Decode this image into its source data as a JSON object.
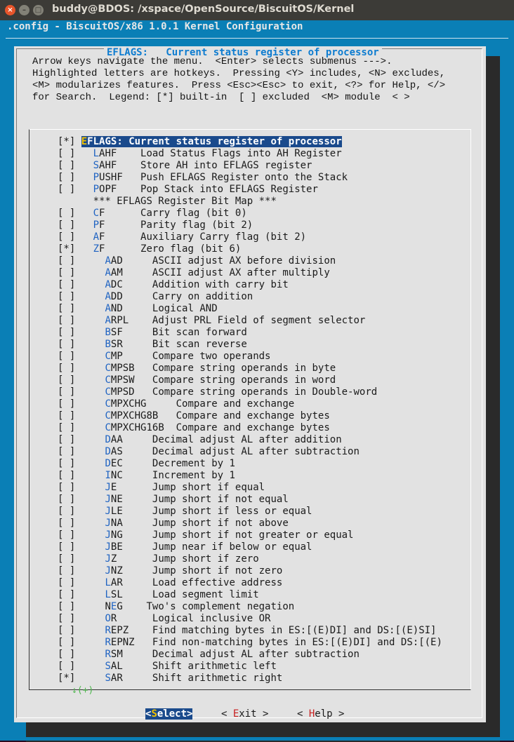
{
  "window": {
    "title": "buddy@BDOS: /xspace/OpenSource/BiscuitOS/Kernel",
    "close_glyph": "×",
    "min_glyph": "–",
    "max_glyph": "□"
  },
  "terminal": {
    "config_title": ".config - BiscuitOS/x86 1.0.1 Kernel Configuration"
  },
  "dialog": {
    "title": "EFLAGS:   Current status register of processor",
    "help_lines": [
      "Arrow keys navigate the menu.  <Enter> selects submenus --->.",
      "Highlighted letters are hotkeys.  Pressing <Y> includes, <N> excludes,",
      "<M> modularizes features.  Press <Esc><Esc> to exit, <?> for Help, </>",
      "for Search.  Legend: [*] built-in  [ ] excluded  <M> module  < >"
    ],
    "more_indicator": "↓(+)",
    "buttons": {
      "select": {
        "hotkey": "S",
        "rest": "elect",
        "prefix": "<",
        "suffix": ">"
      },
      "exit": {
        "hotkey": "E",
        "rest": "xit",
        "prefix": "< ",
        "suffix": " >"
      },
      "help": {
        "hotkey": "H",
        "rest": "elp",
        "prefix": "< ",
        "suffix": " >"
      }
    }
  },
  "menu": [
    {
      "check": "[*]",
      "indent": "",
      "hotkey": "E",
      "name": "FLAGS:",
      "desc": "Current status register of processor",
      "selected": true,
      "pad": 1
    },
    {
      "check": "[ ]",
      "indent": "  ",
      "hotkey": "L",
      "name": "AHF",
      "desc": "Load Status Flags into AH Register",
      "pad": 4
    },
    {
      "check": "[ ]",
      "indent": "  ",
      "hotkey": "S",
      "name": "AHF",
      "desc": "Store AH into EFLAGS register",
      "pad": 4
    },
    {
      "check": "[ ]",
      "indent": "  ",
      "hotkey": "P",
      "name": "USHF",
      "desc": "Push EFLAGS Register onto the Stack",
      "pad": 3
    },
    {
      "check": "[ ]",
      "indent": "  ",
      "hotkey": "P",
      "name": "OPF",
      "desc": "Pop Stack into EFLAGS Register",
      "pad": 4
    },
    {
      "check": "   ",
      "indent": "  ",
      "hotkey": "",
      "name": "*** EFLAGS Register Bit Map ***",
      "desc": "",
      "pad": 0
    },
    {
      "check": "[ ]",
      "indent": "  ",
      "hotkey": "C",
      "name": "F",
      "desc": "Carry flag (bit 0)",
      "pad": 6
    },
    {
      "check": "[ ]",
      "indent": "  ",
      "hotkey": "P",
      "name": "F",
      "desc": "Parity flag (bit 2)",
      "pad": 6
    },
    {
      "check": "[ ]",
      "indent": "  ",
      "hotkey": "A",
      "name": "F",
      "desc": "Auxiliary Carry flag (bit 2)",
      "pad": 6
    },
    {
      "check": "[*]",
      "indent": "  ",
      "hotkey": "Z",
      "name": "F",
      "desc": "Zero flag (bit 6)",
      "pad": 6
    },
    {
      "check": "[ ]",
      "indent": "    ",
      "hotkey": "A",
      "name": "AD",
      "desc": "ASCII adjust AX before division",
      "pad": 5
    },
    {
      "check": "[ ]",
      "indent": "    ",
      "hotkey": "A",
      "name": "AM",
      "desc": "ASCII adjust AX after multiply",
      "pad": 5
    },
    {
      "check": "[ ]",
      "indent": "    ",
      "hotkey": "A",
      "name": "DC",
      "desc": "Addition with carry bit",
      "pad": 5
    },
    {
      "check": "[ ]",
      "indent": "    ",
      "hotkey": "A",
      "name": "DD",
      "desc": "Carry on addition",
      "pad": 5
    },
    {
      "check": "[ ]",
      "indent": "    ",
      "hotkey": "A",
      "name": "ND",
      "desc": "Logical AND",
      "pad": 5
    },
    {
      "check": "[ ]",
      "indent": "    ",
      "hotkey": "A",
      "name": "RPL",
      "desc": "Adjust PRL Field of segment selector",
      "pad": 4
    },
    {
      "check": "[ ]",
      "indent": "    ",
      "hotkey": "B",
      "name": "SF",
      "desc": "Bit scan forward",
      "pad": 5
    },
    {
      "check": "[ ]",
      "indent": "    ",
      "hotkey": "B",
      "name": "SR",
      "desc": "Bit scan reverse",
      "pad": 5
    },
    {
      "check": "[ ]",
      "indent": "    ",
      "hotkey": "C",
      "name": "MP",
      "desc": "Compare two operands",
      "pad": 5
    },
    {
      "check": "[ ]",
      "indent": "    ",
      "hotkey": "C",
      "name": "MPSB",
      "desc": "Compare string operands in byte",
      "pad": 3
    },
    {
      "check": "[ ]",
      "indent": "    ",
      "hotkey": "C",
      "name": "MPSW",
      "desc": "Compare string operands in word",
      "pad": 3
    },
    {
      "check": "[ ]",
      "indent": "    ",
      "hotkey": "C",
      "name": "MPSD",
      "desc": "Compare string operands in Double-word",
      "pad": 3
    },
    {
      "check": "[ ]",
      "indent": "    ",
      "hotkey": "C",
      "name": "MPXCHG",
      "desc": "Compare and exchange",
      "pad": 5
    },
    {
      "check": "[ ]",
      "indent": "    ",
      "hotkey": "C",
      "name": "MPXCHG8B",
      "desc": "Compare and exchange bytes",
      "pad": 3
    },
    {
      "check": "[ ]",
      "indent": "    ",
      "hotkey": "C",
      "name": "MPXCHG16B",
      "desc": "Compare and exchange bytes",
      "pad": 2
    },
    {
      "check": "[ ]",
      "indent": "    ",
      "hotkey": "D",
      "name": "AA",
      "desc": "Decimal adjust AL after addition",
      "pad": 5
    },
    {
      "check": "[ ]",
      "indent": "    ",
      "hotkey": "D",
      "name": "AS",
      "desc": "Decimal adjust AL after subtraction",
      "pad": 5
    },
    {
      "check": "[ ]",
      "indent": "    ",
      "hotkey": "D",
      "name": "EC",
      "desc": "Decrement by 1",
      "pad": 5
    },
    {
      "check": "[ ]",
      "indent": "    ",
      "hotkey": "I",
      "name": "NC",
      "desc": "Increment by 1",
      "pad": 5
    },
    {
      "check": "[ ]",
      "indent": "    ",
      "hotkey": "J",
      "name": "E",
      "desc": "Jump short if equal",
      "pad": 6
    },
    {
      "check": "[ ]",
      "indent": "    ",
      "hotkey": "J",
      "name": "NE",
      "desc": "Jump short if not equal",
      "pad": 5
    },
    {
      "check": "[ ]",
      "indent": "    ",
      "hotkey": "J",
      "name": "LE",
      "desc": "Jump short if less or equal",
      "pad": 5
    },
    {
      "check": "[ ]",
      "indent": "    ",
      "hotkey": "J",
      "name": "NA",
      "desc": "Jump short if not above",
      "pad": 5
    },
    {
      "check": "[ ]",
      "indent": "    ",
      "hotkey": "J",
      "name": "NG",
      "desc": "Jump short if not greater or equal",
      "pad": 5
    },
    {
      "check": "[ ]",
      "indent": "    ",
      "hotkey": "J",
      "name": "BE",
      "desc": "Jump near if below or equal",
      "pad": 5
    },
    {
      "check": "[ ]",
      "indent": "    ",
      "hotkey": "J",
      "name": "Z",
      "desc": "Jump short if zero",
      "pad": 6
    },
    {
      "check": "[ ]",
      "indent": "    ",
      "hotkey": "J",
      "name": "NZ",
      "desc": "Jump short if not zero",
      "pad": 5
    },
    {
      "check": "[ ]",
      "indent": "    ",
      "hotkey": "L",
      "name": "AR",
      "desc": "Load effective address",
      "pad": 5
    },
    {
      "check": "[ ]",
      "indent": "    ",
      "hotkey": "L",
      "name": "SL",
      "desc": "Load segment limit",
      "pad": 5
    },
    {
      "check": "[ ]",
      "indent": "    ",
      "hotkey": "",
      "name": "NEG",
      "desc": "Two's complement negation",
      "pad": 4,
      "hk_index": 1
    },
    {
      "check": "[ ]",
      "indent": "    ",
      "hotkey": "O",
      "name": "R",
      "desc": "Logical inclusive OR",
      "pad": 6
    },
    {
      "check": "[ ]",
      "indent": "    ",
      "hotkey": "R",
      "name": "EPZ",
      "desc": "Find matching bytes in ES:[(E)DI] and DS:[(E)SI]",
      "pad": 4
    },
    {
      "check": "[ ]",
      "indent": "    ",
      "hotkey": "R",
      "name": "EPNZ",
      "desc": "Find non-matching bytes in ES:[(E)DI] and DS:[(E)",
      "pad": 3
    },
    {
      "check": "[ ]",
      "indent": "    ",
      "hotkey": "R",
      "name": "SM",
      "desc": "Decimal adjust AL after subtraction",
      "pad": 5
    },
    {
      "check": "[ ]",
      "indent": "    ",
      "hotkey": "S",
      "name": "AL",
      "desc": "Shift arithmetic left",
      "pad": 5
    },
    {
      "check": "[*]",
      "indent": "    ",
      "hotkey": "S",
      "name": "AR",
      "desc": "Shift arithmetic right",
      "pad": 5
    }
  ]
}
